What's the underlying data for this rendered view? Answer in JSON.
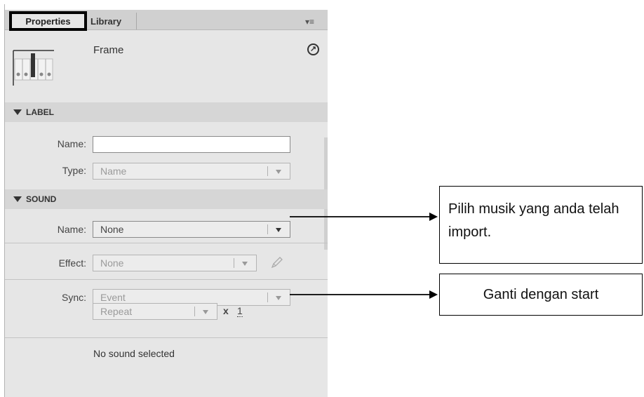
{
  "tabs": {
    "properties": "Properties",
    "library": "Library"
  },
  "header": {
    "title": "Frame"
  },
  "label_section": {
    "title": "LABEL",
    "name_label": "Name:",
    "name_value": "",
    "type_label": "Type:",
    "type_value": "Name"
  },
  "sound_section": {
    "title": "SOUND",
    "name_label": "Name:",
    "name_value": "None",
    "effect_label": "Effect:",
    "effect_value": "None",
    "sync_label": "Sync:",
    "sync_value": "Event",
    "repeat_value": "Repeat",
    "x_label": "x",
    "repeat_count": "1",
    "status": "No sound selected"
  },
  "annotations": {
    "callout1": "Pilih musik yang anda telah import.",
    "callout2": "Ganti dengan start"
  },
  "icons": [
    "panel-menu-icon",
    "goto-icon",
    "pencil-icon",
    "collapse-triangle-icon",
    "dropdown-arrow-icon"
  ]
}
